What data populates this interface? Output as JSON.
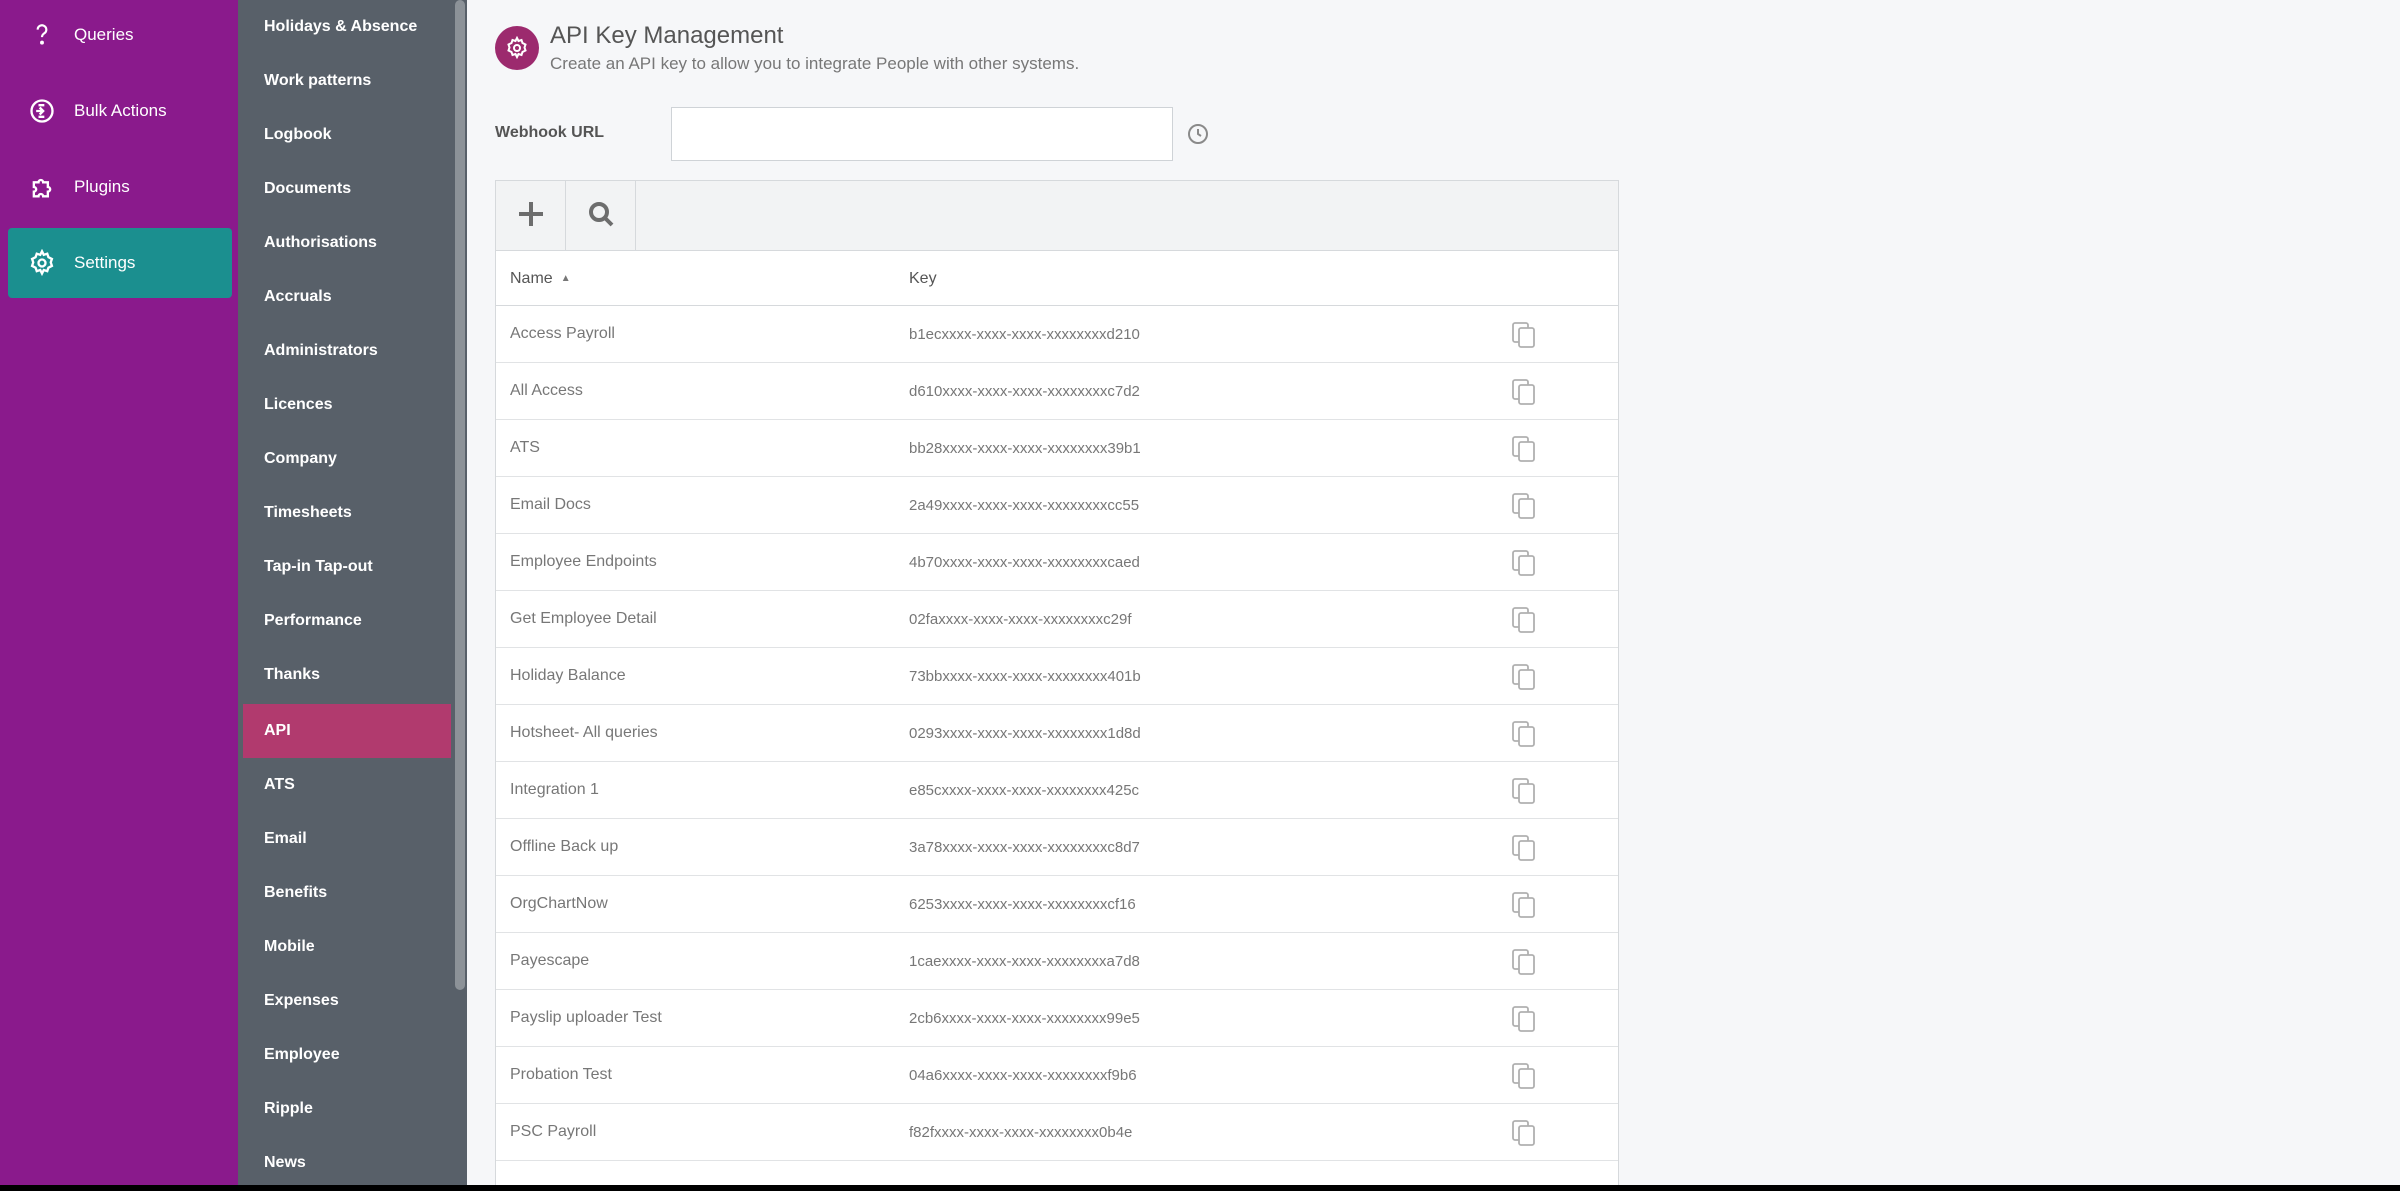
{
  "primary_nav": {
    "items": [
      {
        "label": "Queries",
        "icon": "question-icon",
        "active": false
      },
      {
        "label": "Bulk Actions",
        "icon": "bulk-actions-icon",
        "active": false
      },
      {
        "label": "Plugins",
        "icon": "puzzle-icon",
        "active": false
      },
      {
        "label": "Settings",
        "icon": "gear-icon",
        "active": true
      }
    ]
  },
  "secondary_nav": {
    "items": [
      {
        "label": "Holidays & Absence"
      },
      {
        "label": "Work patterns"
      },
      {
        "label": "Logbook"
      },
      {
        "label": "Documents"
      },
      {
        "label": "Authorisations"
      },
      {
        "label": "Accruals"
      },
      {
        "label": "Administrators"
      },
      {
        "label": "Licences"
      },
      {
        "label": "Company"
      },
      {
        "label": "Timesheets"
      },
      {
        "label": "Tap-in Tap-out"
      },
      {
        "label": "Performance"
      },
      {
        "label": "Thanks"
      },
      {
        "label": "API",
        "active": true
      },
      {
        "label": "ATS"
      },
      {
        "label": "Email"
      },
      {
        "label": "Benefits"
      },
      {
        "label": "Mobile"
      },
      {
        "label": "Expenses"
      },
      {
        "label": "Employee"
      },
      {
        "label": "Ripple"
      },
      {
        "label": "News"
      }
    ]
  },
  "header": {
    "icon": "gear-icon",
    "title": "API Key Management",
    "subtitle": "Create an API key to allow you to integrate People with other systems."
  },
  "webhook": {
    "label": "Webhook URL",
    "value": "",
    "placeholder": "",
    "history_icon": "clock-icon"
  },
  "toolbar": {
    "add_icon": "plus-icon",
    "search_icon": "search-icon"
  },
  "table": {
    "columns": [
      {
        "label": "Name",
        "sort": "ascending"
      },
      {
        "label": "Key"
      }
    ],
    "rows": [
      {
        "name": "Access Payroll",
        "key": "b1ecxxxx-xxxx-xxxx-xxxxxxxxd210"
      },
      {
        "name": "All Access",
        "key": "d610xxxx-xxxx-xxxx-xxxxxxxxc7d2"
      },
      {
        "name": "ATS",
        "key": "bb28xxxx-xxxx-xxxx-xxxxxxxx39b1"
      },
      {
        "name": "Email Docs",
        "key": "2a49xxxx-xxxx-xxxx-xxxxxxxxcc55"
      },
      {
        "name": "Employee Endpoints",
        "key": "4b70xxxx-xxxx-xxxx-xxxxxxxxcaed"
      },
      {
        "name": "Get Employee Detail",
        "key": "02faxxxx-xxxx-xxxx-xxxxxxxxc29f"
      },
      {
        "name": "Holiday Balance",
        "key": "73bbxxxx-xxxx-xxxx-xxxxxxxx401b"
      },
      {
        "name": "Hotsheet- All queries",
        "key": "0293xxxx-xxxx-xxxx-xxxxxxxx1d8d"
      },
      {
        "name": "Integration 1",
        "key": "e85cxxxx-xxxx-xxxx-xxxxxxxx425c"
      },
      {
        "name": "Offline Back up",
        "key": "3a78xxxx-xxxx-xxxx-xxxxxxxxc8d7"
      },
      {
        "name": "OrgChartNow",
        "key": "6253xxxx-xxxx-xxxx-xxxxxxxxcf16"
      },
      {
        "name": "Payescape",
        "key": "1caexxxx-xxxx-xxxx-xxxxxxxxa7d8"
      },
      {
        "name": "Payslip uploader Test",
        "key": "2cb6xxxx-xxxx-xxxx-xxxxxxxx99e5"
      },
      {
        "name": "Probation Test",
        "key": "04a6xxxx-xxxx-xxxx-xxxxxxxxf9b6"
      },
      {
        "name": "PSC Payroll",
        "key": "f82fxxxx-xxxx-xxxx-xxxxxxxx0b4e"
      }
    ],
    "copy_icon": "copy-icon"
  },
  "colors": {
    "primary_nav_bg": "#8a1a8c",
    "primary_nav_active": "#1b8f8f",
    "secondary_nav_bg": "#586069",
    "secondary_nav_active": "#b13a6e",
    "header_icon_bg": "#9c2a6e"
  }
}
